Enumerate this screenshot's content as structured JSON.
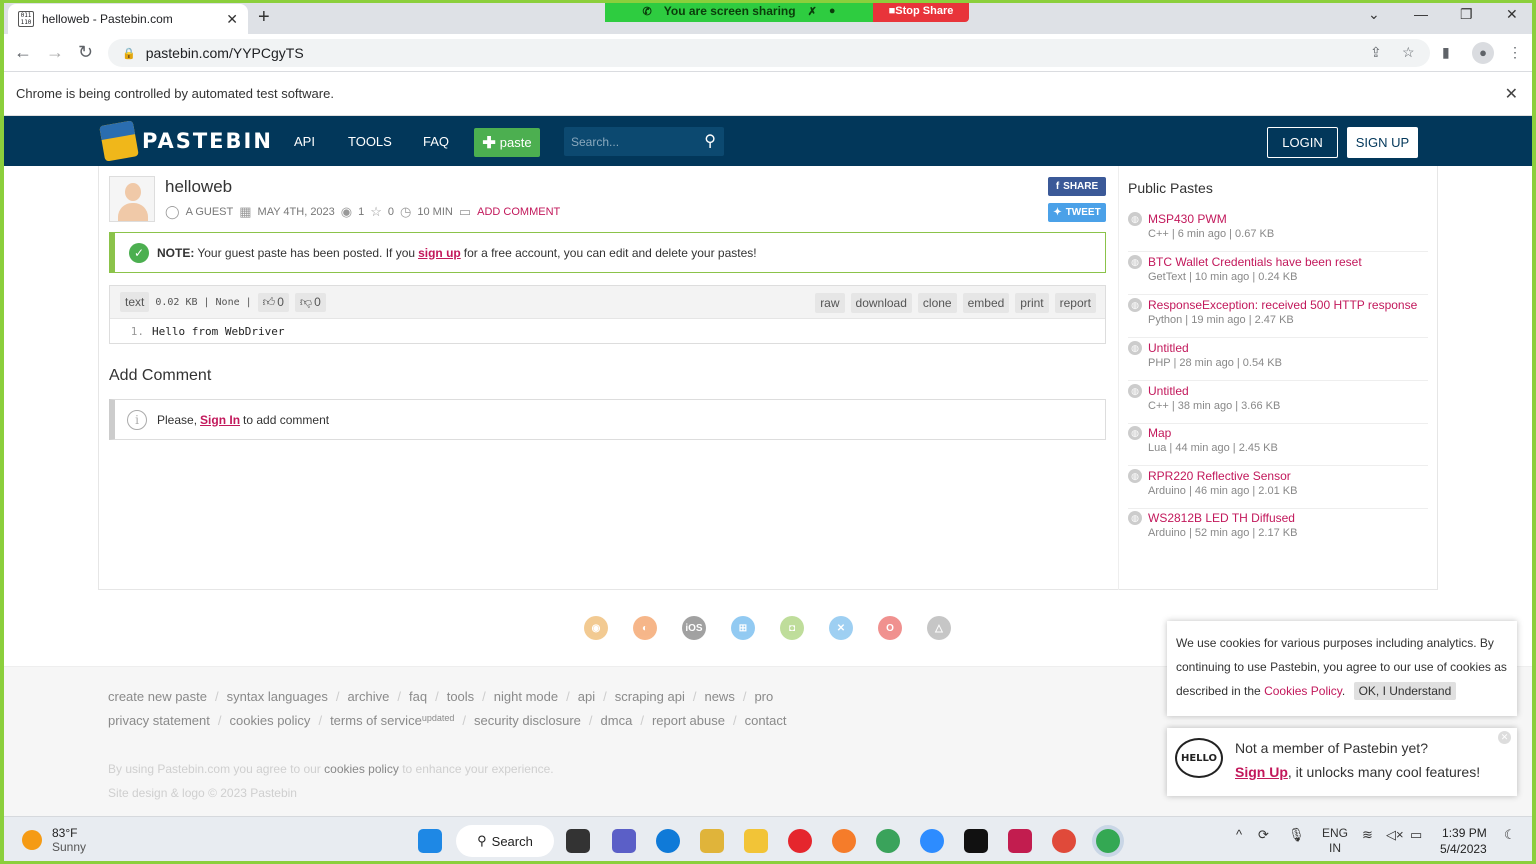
{
  "browser": {
    "tab_title": "helloweb - Pastebin.com",
    "tab_favicon": "011 110",
    "url": "pastebin.com/YYPCgyTS",
    "automation_notice": "Chrome is being controlled by automated test software.",
    "screen_share_text": "You are screen sharing",
    "stop_share_label": "Stop Share"
  },
  "header": {
    "logo": "PASTEBIN",
    "nav": [
      "API",
      "TOOLS",
      "FAQ"
    ],
    "paste_label": "paste",
    "search_placeholder": "Search...",
    "login": "LOGIN",
    "signup": "SIGN UP"
  },
  "paste": {
    "title": "helloweb",
    "author": "A GUEST",
    "date": "MAY 4TH, 2023",
    "views": "1",
    "stars": "0",
    "expire": "10 MIN",
    "add_comment": "ADD COMMENT",
    "share": "SHARE",
    "tweet": "TWEET",
    "note_label": "NOTE:",
    "note_pre": "Your guest paste has been posted. If you",
    "note_link": "sign up",
    "note_post": "for a free account, you can edit and delete your pastes!",
    "syntax": "text",
    "size": "0.02 KB",
    "category": "None",
    "likes": "0",
    "dislikes": "0",
    "actions": [
      "raw",
      "download",
      "clone",
      "embed",
      "print",
      "report"
    ],
    "line_no": "1.",
    "code": "Hello from WebDriver"
  },
  "comments": {
    "heading": "Add Comment",
    "pre": "Please,",
    "link": "Sign In",
    "post": "to add comment"
  },
  "sidebar": {
    "title": "Public Pastes",
    "items": [
      {
        "name": "MSP430 PWM",
        "meta": "C++ | 6 min ago | 0.67 KB"
      },
      {
        "name": "BTC Wallet Credentials have been reset",
        "meta": "GetText | 10 min ago | 0.24 KB"
      },
      {
        "name": "ResponseException: received 500 HTTP response",
        "meta": "Python | 19 min ago | 2.47 KB"
      },
      {
        "name": "Untitled",
        "meta": "PHP | 28 min ago | 0.54 KB"
      },
      {
        "name": "Untitled",
        "meta": "C++ | 38 min ago | 3.66 KB"
      },
      {
        "name": "Map",
        "meta": "Lua | 44 min ago | 2.45 KB"
      },
      {
        "name": "RPR220 Reflective Sensor",
        "meta": "Arduino | 46 min ago | 2.01 KB"
      },
      {
        "name": "WS2812B LED TH Diffused",
        "meta": "Arduino | 52 min ago | 2.17 KB"
      }
    ]
  },
  "platforms": {
    "ios_label": "iOS"
  },
  "footer": {
    "row1": [
      "create new paste",
      "syntax languages",
      "archive",
      "faq",
      "tools",
      "night mode",
      "api",
      "scraping api",
      "news",
      "pro"
    ],
    "row2": [
      "privacy statement",
      "cookies policy",
      "terms of service",
      "security disclosure",
      "dmca",
      "report abuse",
      "contact"
    ],
    "tos_badge": "updated",
    "notice_pre": "By using Pastebin.com you agree to our",
    "notice_link": "cookies policy",
    "notice_post": "to enhance your experience.",
    "copyright": "Site design & logo © 2023 Pastebin"
  },
  "cookie": {
    "text_pre": "We use cookies for various purposes including analytics. By continuing to use Pastebin, you agree to our use of cookies as described in the",
    "link": "Cookies Policy",
    "ok": "OK, I Understand"
  },
  "member": {
    "hello": "HELLO",
    "line1": "Not a member of Pastebin yet?",
    "link": "Sign Up",
    "line2": ", it unlocks many cool features!"
  },
  "taskbar": {
    "temp": "83°F",
    "condition": "Sunny",
    "search": "Search",
    "lang1": "ENG",
    "lang2": "IN",
    "time": "1:39 PM",
    "date": "5/4/2023"
  },
  "colors": {
    "header_bg": "#02375a",
    "accent": "#c2185b",
    "paste_btn": "#4caf50",
    "note_border": "#8bc34a"
  }
}
